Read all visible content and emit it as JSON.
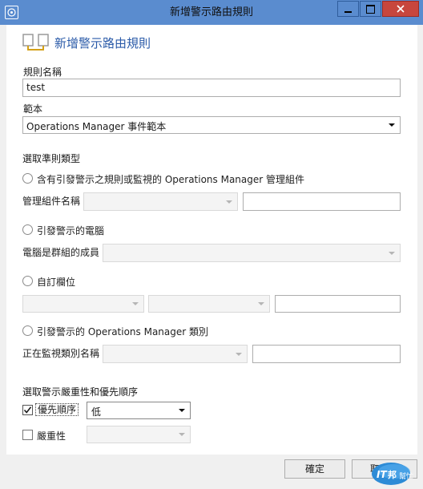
{
  "window": {
    "title": "新增警示路由規則"
  },
  "header": {
    "title": "新增警示路由規則"
  },
  "rule_name": {
    "label": "規則名稱",
    "value": "test"
  },
  "template": {
    "label": "範本",
    "value": "Operations Manager 事件範本"
  },
  "criteria": {
    "title": "選取準則類型",
    "option1": {
      "label": "含有引發警示之規則或監視的 Operations Manager 管理組件",
      "field_label": "管理組件名稱"
    },
    "option2": {
      "label": "引發警示的電腦",
      "field_label": "電腦是群組的成員"
    },
    "option3": {
      "label": "自訂欄位"
    },
    "option4": {
      "label": "引發警示的 Operations Manager 類別",
      "field_label": "正在監視類別名稱"
    }
  },
  "severity_section": {
    "title": "選取警示嚴重性和優先順序",
    "priority": {
      "label": "優先順序",
      "value": "低",
      "checked": true
    },
    "severity": {
      "label": "嚴重性",
      "checked": false
    }
  },
  "buttons": {
    "ok": "確定",
    "cancel": "取"
  },
  "watermark": {
    "text_it": "IT",
    "text_bang": "邦",
    "text_help": "幫忙"
  },
  "colors": {
    "titlebar": "#5a8ccf",
    "close": "#c7463d",
    "accent_text": "#2a5aa8"
  }
}
